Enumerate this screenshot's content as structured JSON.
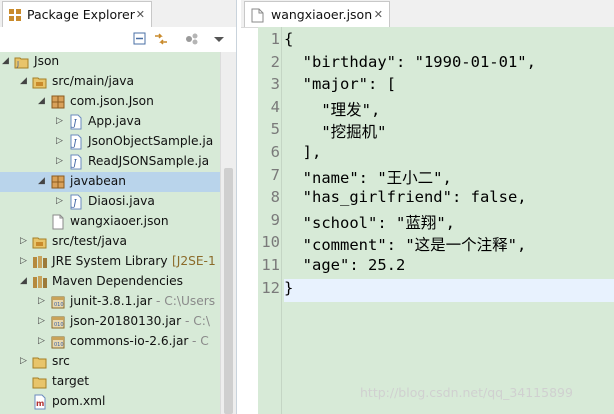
{
  "package_explorer": {
    "tab_label": "Package Explorer",
    "tab_close": "✕",
    "tree": [
      {
        "label": "Json",
        "level": 0,
        "icon": "java-project-icon"
      },
      {
        "label": "src/main/java",
        "level": 1,
        "icon": "source-folder-icon"
      },
      {
        "label": "com.json.Json",
        "level": 2,
        "icon": "package-icon"
      },
      {
        "label": "App.java",
        "level": 3,
        "icon": "java-file-icon"
      },
      {
        "label": "JsonObjectSample.ja",
        "level": 3,
        "icon": "java-file-icon"
      },
      {
        "label": "ReadJSONSample.ja",
        "level": 3,
        "icon": "java-file-icon"
      },
      {
        "label": "javabean",
        "level": 2,
        "icon": "package-icon",
        "selected": true
      },
      {
        "label": "Diaosi.java",
        "level": 3,
        "icon": "java-file-icon"
      },
      {
        "label": "wangxiaoer.json",
        "level": 2,
        "icon": "json-file-icon"
      },
      {
        "label": "src/test/java",
        "level": 1,
        "icon": "source-folder-icon"
      },
      {
        "label": "JRE System Library",
        "suffix": "[J2SE-1",
        "level": 1,
        "icon": "library-icon"
      },
      {
        "label": "Maven Dependencies",
        "level": 1,
        "icon": "library-icon"
      },
      {
        "label": "junit-3.8.1.jar",
        "suffix": "- C:\\Users",
        "level": 2,
        "icon": "jar-icon"
      },
      {
        "label": "json-20180130.jar",
        "suffix": "- C:\\",
        "level": 2,
        "icon": "jar-icon"
      },
      {
        "label": "commons-io-2.6.jar",
        "suffix": "- C",
        "level": 2,
        "icon": "jar-icon"
      },
      {
        "label": "src",
        "level": 1,
        "icon": "folder-icon"
      },
      {
        "label": "target",
        "level": 1,
        "icon": "folder-icon"
      },
      {
        "label": "pom.xml",
        "level": 1,
        "icon": "xml-file-icon"
      }
    ]
  },
  "editor": {
    "tab_label": "wangxiaoer.json",
    "tab_close": "✕",
    "line_numbers": [
      "1",
      "2",
      "3",
      "4",
      "5",
      "6",
      "7",
      "8",
      "9",
      "10",
      "11",
      "12"
    ],
    "lines": [
      "{",
      "  \"birthday\": \"1990-01-01\",",
      "  \"major\": [",
      "    \"理发\",",
      "    \"挖掘机\"",
      "  ],",
      "  \"name\": \"王小二\",",
      "  \"has_girlfriend\": false,",
      "  \"school\": \"蓝翔\",",
      "  \"comment\": \"这是一个注释\",",
      "  \"age\": 25.2",
      "}"
    ],
    "current_line": 12
  },
  "watermark": "http://blog.csdn.net/qq_34115899",
  "colors": {
    "editor_bg": "#d7ead7",
    "selection": "#b9d4eb",
    "current_line": "#e8f2fe"
  }
}
